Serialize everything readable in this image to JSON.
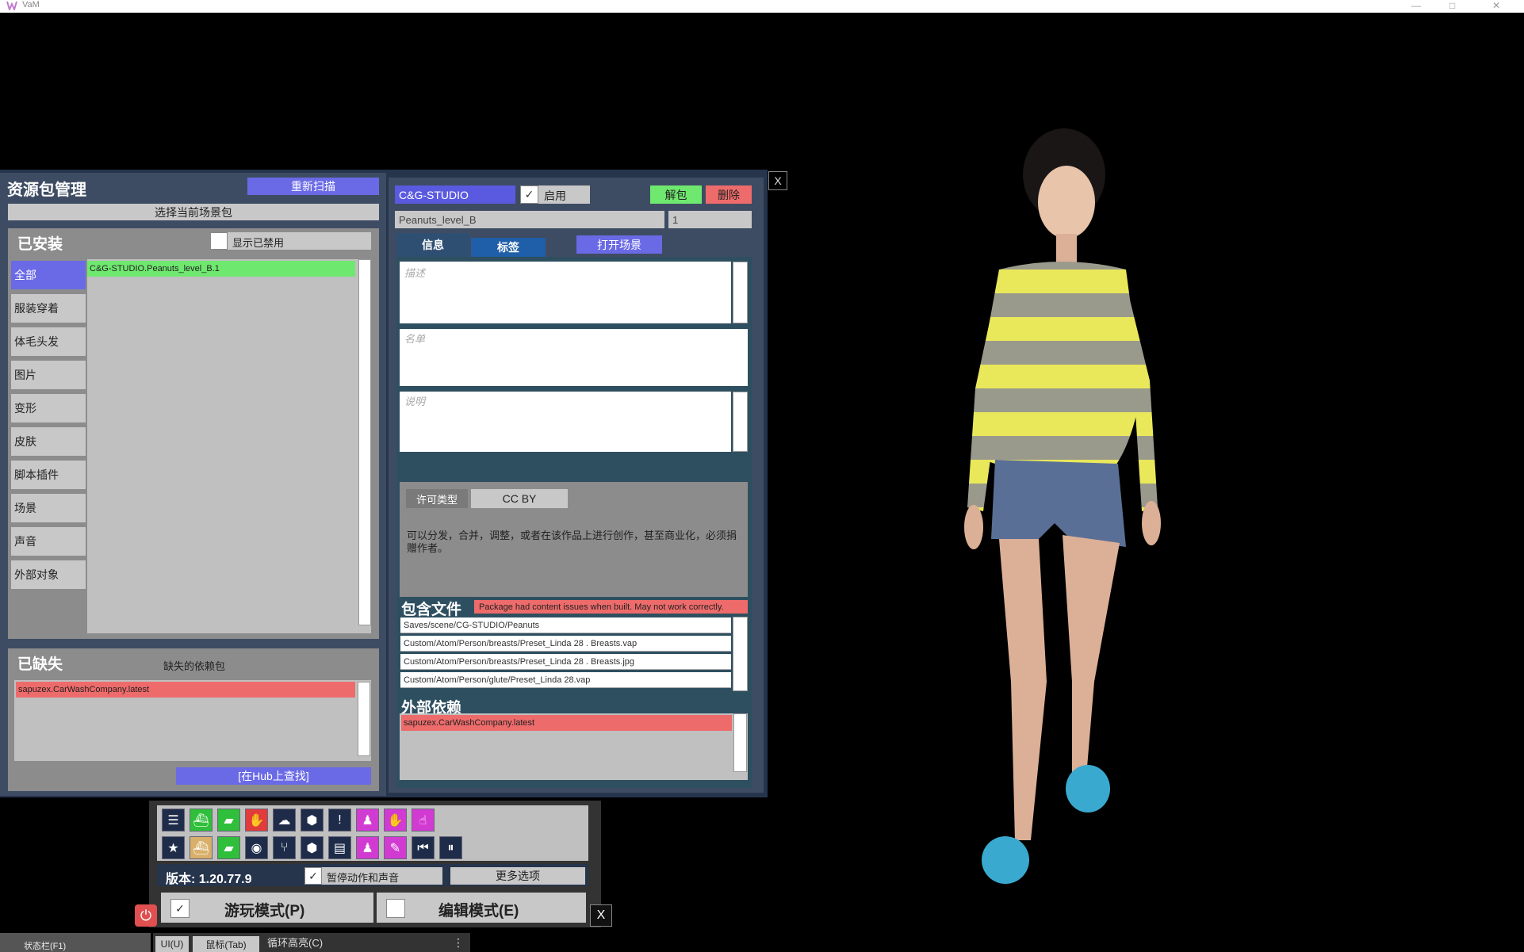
{
  "window": {
    "title": "VaM",
    "min": "—",
    "max": "□",
    "close": "✕"
  },
  "left": {
    "title": "资源包管理",
    "rescan": "重新扫描",
    "select_scene_pkg": "选择当前场景包",
    "installed_title": "已安装",
    "show_disabled": "显示已禁用",
    "categories": [
      "全部",
      "服装穿着",
      "体毛头发",
      "图片",
      "变形",
      "皮肤",
      "脚本插件",
      "场景",
      "声音",
      "外部对象"
    ],
    "installed_items": [
      "C&G-STUDIO.Peanuts_level_B.1"
    ],
    "missing_title": "已缺失",
    "missing_deps_label": "缺失的依赖包",
    "missing_items": [
      "sapuzex.CarWashCompany.latest"
    ],
    "find_on_hub": "[在Hub上查找]"
  },
  "right": {
    "creator": "C&G-STUDIO",
    "enabled_label": "启用",
    "unpack": "解包",
    "delete": "删除",
    "package_name": "Peanuts_level_B",
    "version": "1",
    "tab_info": "信息",
    "tab_tags": "标签",
    "open_scene": "打开场景",
    "desc_placeholder": "描述",
    "credits_placeholder": "名单",
    "instructions_placeholder": "说明",
    "license_label": "许可类型",
    "license_value": "CC BY",
    "license_desc": "可以分发，合并，调整，或者在该作品上进行创作，甚至商业化，必须捐赠作者。",
    "contents_title": "包含文件",
    "content_warning": "Package had content issues when built. May not work correctly.",
    "files": [
      "Saves/scene/CG-STUDIO/Peanuts",
      "Custom/Atom/Person/breasts/Preset_Linda 28 . Breasts.vap",
      "Custom/Atom/Person/breasts/Preset_Linda 28 . Breasts.jpg",
      "Custom/Atom/Person/glute/Preset_Linda 28.vap"
    ],
    "external_deps_title": "外部依赖",
    "external_deps": [
      "sapuzex.CarWashCompany.latest"
    ]
  },
  "panel_close": "X",
  "toolbar": {
    "version_label": "版本: 1.20.77.9",
    "pause_label": "暂停动作和声音",
    "more_options": "更多选项",
    "play_mode": "游玩模式(P)",
    "edit_mode": "编辑模式(E)",
    "close": "X",
    "icons_row1": [
      "menu-icon",
      "scene-open-icon",
      "folder-icon",
      "hand-red-icon",
      "cloud-upload-icon",
      "package-icon",
      "alert-icon",
      "person-add-icon",
      "hand-icon",
      "pointer-hand-icon"
    ],
    "icons_row2": [
      "star-icon",
      "scene-save-icon",
      "folder-save-icon",
      "camera-icon",
      "nodes-icon",
      "hub-package-icon",
      "document-icon",
      "person-settings-icon",
      "wrench-icon",
      "skip-back-icon",
      "pause-icon"
    ]
  },
  "bottom": {
    "status_bar": "状态栏(F1)",
    "ui_btn": "UI(U)",
    "mouse_btn": "鼠标(Tab)",
    "loop_highlight": "循环高亮(C)",
    "more": "⋮"
  },
  "check_mark": "✓",
  "colors": {
    "accent_blue": "#6a6ae6",
    "tab_blue": "#1f5ea8",
    "green": "#6fe86f",
    "red": "#ee6b6b",
    "panel": "#3e4c63"
  }
}
